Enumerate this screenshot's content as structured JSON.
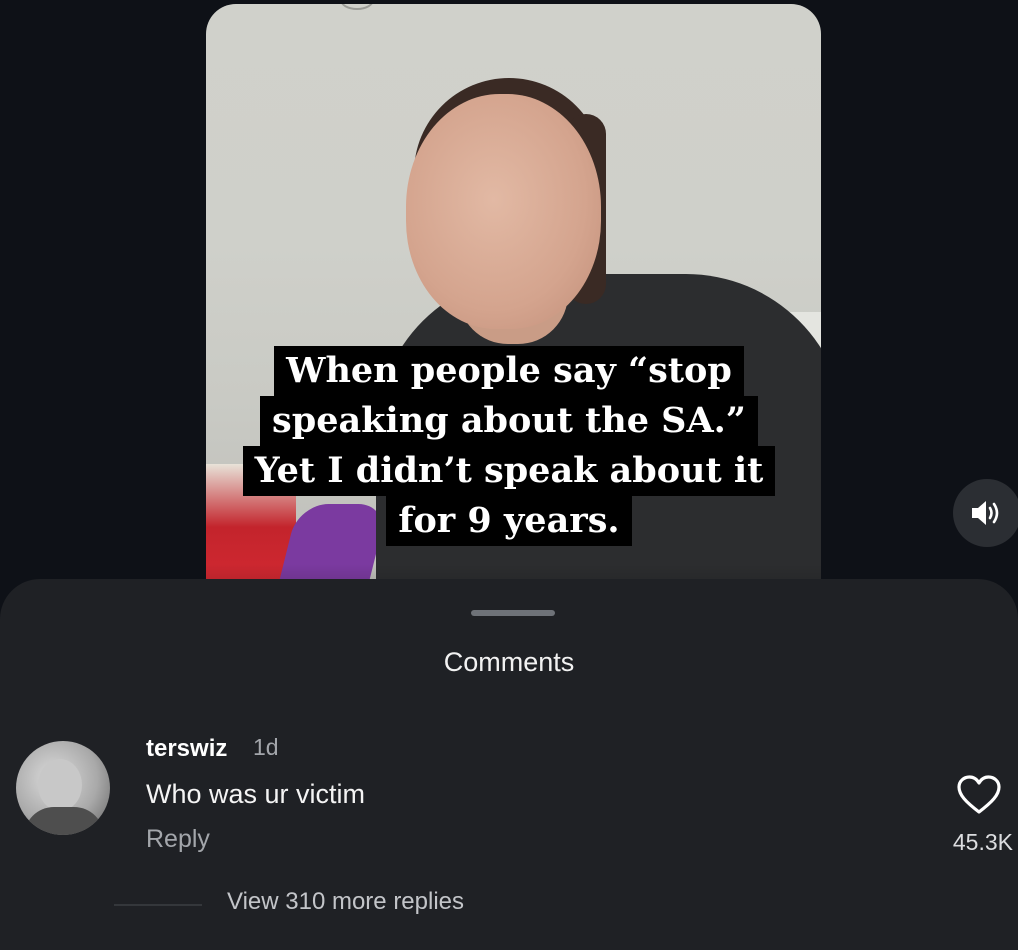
{
  "video": {
    "caption_lines": [
      "When people say “stop",
      "speaking about the SA.”",
      "Yet I didn’t speak about it",
      "for 9 years."
    ],
    "volume_icon": "speaker-volume-icon"
  },
  "comments_sheet": {
    "title": "Comments",
    "comment": {
      "username": "terswiz",
      "timestamp": "1d",
      "text": "Who was ur victim",
      "reply_label": "Reply",
      "like_icon": "heart-outline-icon",
      "like_count": "45.3K",
      "view_replies_label": "View 310 more replies"
    }
  },
  "colors": {
    "background": "#0e1117",
    "sheet": "#1f2125",
    "caption_box": "#000000",
    "caption_text": "#ffffff",
    "secondary_text": "#a3a6ab"
  }
}
